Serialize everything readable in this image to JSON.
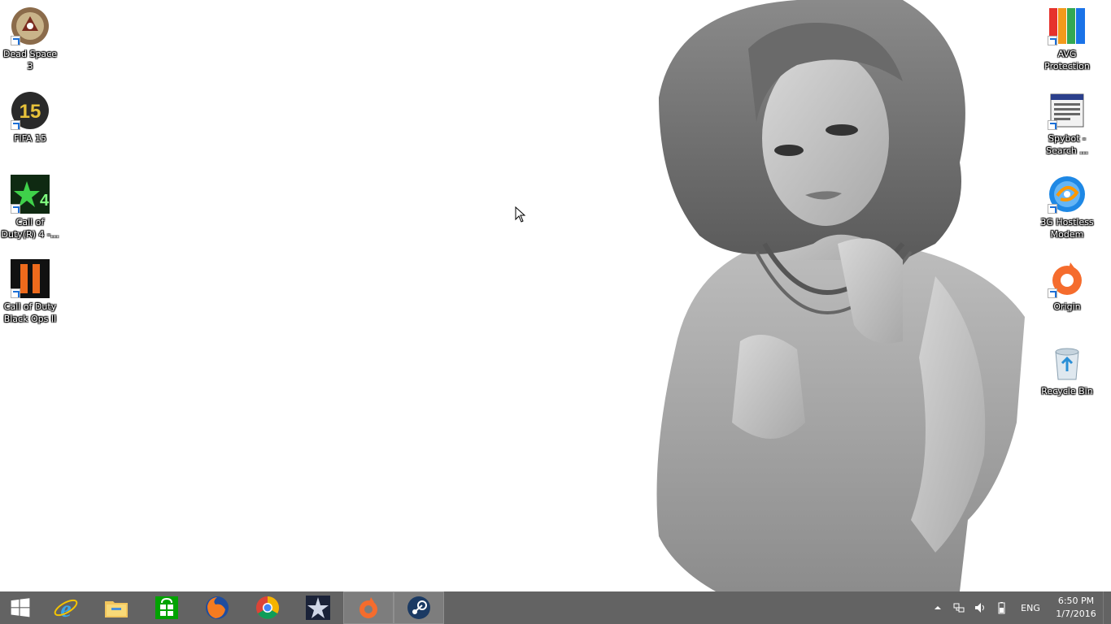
{
  "desktop": {
    "left_icons": [
      {
        "label": "Dead Space 3",
        "icon": "dead-space-icon"
      },
      {
        "label": "FIFA 15",
        "icon": "fifa-icon"
      },
      {
        "label": "Call of Duty(R) 4 -...",
        "icon": "cod4-icon"
      },
      {
        "label": "Call of Duty Black Ops II",
        "icon": "black-ops-icon"
      }
    ],
    "right_icons": [
      {
        "label": "AVG Protection",
        "icon": "avg-icon"
      },
      {
        "label": "Spybot - Search ...",
        "icon": "spybot-icon"
      },
      {
        "label": "3G Hostless Modem",
        "icon": "modem-icon"
      },
      {
        "label": "Origin",
        "icon": "origin-icon"
      },
      {
        "label": "Recycle Bin",
        "icon": "recycle-bin-icon"
      }
    ]
  },
  "taskbar": {
    "pinned": [
      {
        "name": "start",
        "icon": "windows-logo-icon"
      },
      {
        "name": "internet-explorer",
        "icon": "ie-icon"
      },
      {
        "name": "file-explorer",
        "icon": "folder-icon"
      },
      {
        "name": "store",
        "icon": "store-icon"
      },
      {
        "name": "firefox",
        "icon": "firefox-icon"
      },
      {
        "name": "chrome",
        "icon": "chrome-icon"
      },
      {
        "name": "star-app",
        "icon": "star-icon"
      },
      {
        "name": "origin",
        "icon": "origin-icon"
      },
      {
        "name": "steam",
        "icon": "steam-icon"
      }
    ],
    "tray": {
      "language": "ENG",
      "time": "6:50 PM",
      "date": "1/7/2016"
    }
  },
  "colors": {
    "taskbar": "#636363",
    "running": "#7d7d7d",
    "desktop": "#ffffff"
  }
}
